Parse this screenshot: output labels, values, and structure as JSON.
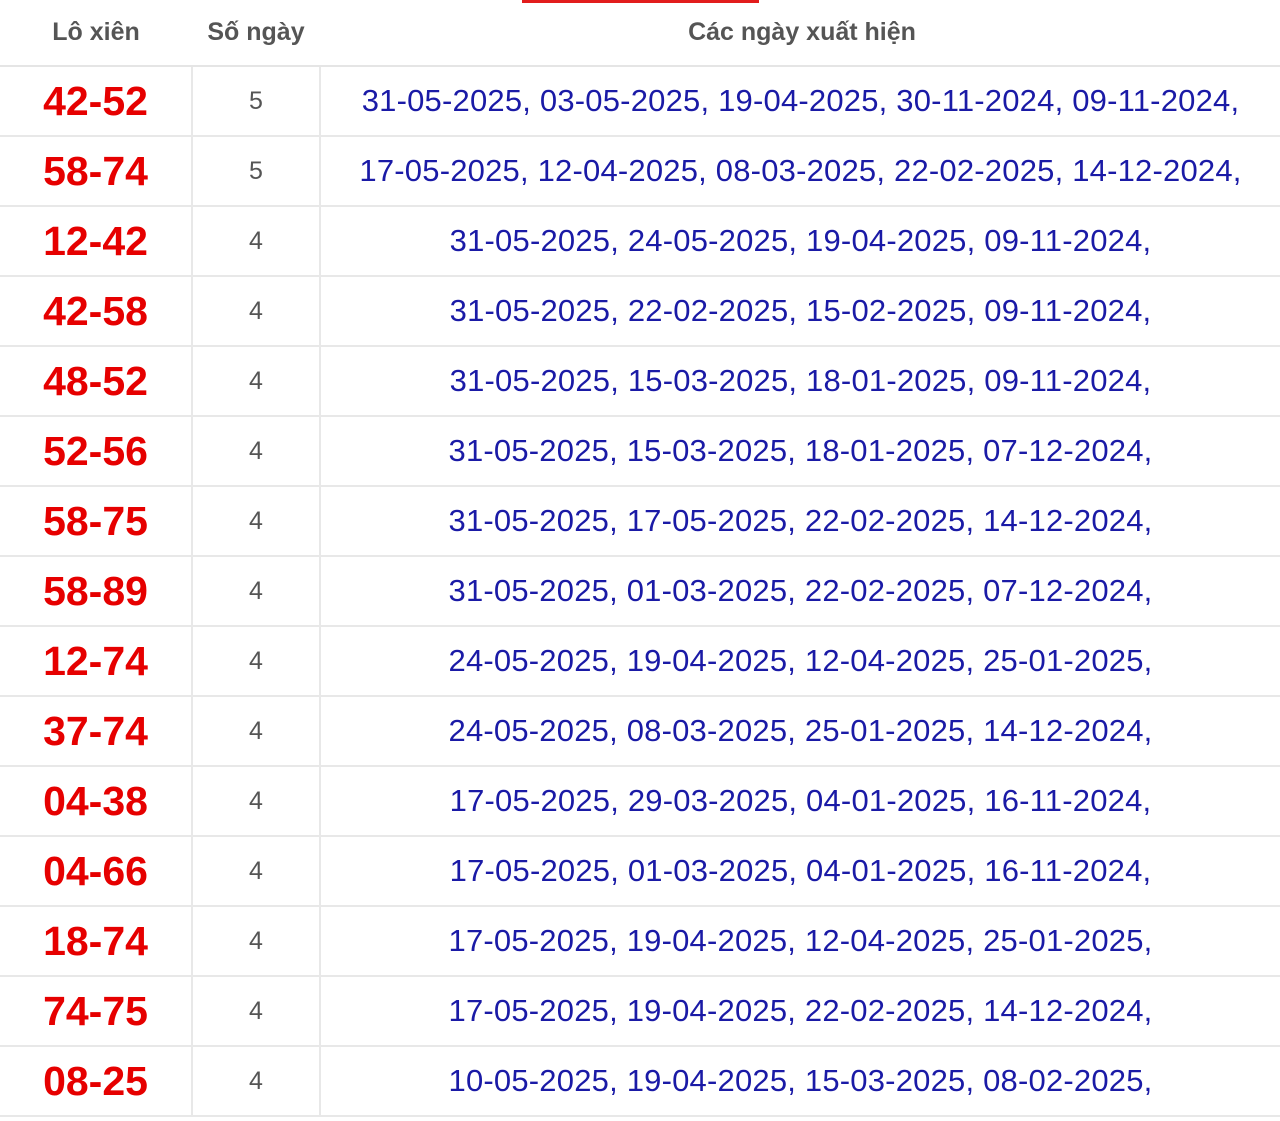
{
  "header": {
    "pair_label": "Lô xiên",
    "days_label": "Số ngày",
    "dates_label": "Các ngày xuất hiện"
  },
  "accent_color": "#e21c1c",
  "colors": {
    "pair_text": "#e60000",
    "dates_text": "#1a1aa6",
    "days_text": "#555555"
  },
  "rows": [
    {
      "pair": "42-52",
      "days": "5",
      "dates": "31-05-2025, 03-05-2025, 19-04-2025, 30-11-2024, 09-11-2024,"
    },
    {
      "pair": "58-74",
      "days": "5",
      "dates": "17-05-2025, 12-04-2025, 08-03-2025, 22-02-2025, 14-12-2024,"
    },
    {
      "pair": "12-42",
      "days": "4",
      "dates": "31-05-2025, 24-05-2025, 19-04-2025, 09-11-2024,"
    },
    {
      "pair": "42-58",
      "days": "4",
      "dates": "31-05-2025, 22-02-2025, 15-02-2025, 09-11-2024,"
    },
    {
      "pair": "48-52",
      "days": "4",
      "dates": "31-05-2025, 15-03-2025, 18-01-2025, 09-11-2024,"
    },
    {
      "pair": "52-56",
      "days": "4",
      "dates": "31-05-2025, 15-03-2025, 18-01-2025, 07-12-2024,"
    },
    {
      "pair": "58-75",
      "days": "4",
      "dates": "31-05-2025, 17-05-2025, 22-02-2025, 14-12-2024,"
    },
    {
      "pair": "58-89",
      "days": "4",
      "dates": "31-05-2025, 01-03-2025, 22-02-2025, 07-12-2024,"
    },
    {
      "pair": "12-74",
      "days": "4",
      "dates": "24-05-2025, 19-04-2025, 12-04-2025, 25-01-2025,"
    },
    {
      "pair": "37-74",
      "days": "4",
      "dates": "24-05-2025, 08-03-2025, 25-01-2025, 14-12-2024,"
    },
    {
      "pair": "04-38",
      "days": "4",
      "dates": "17-05-2025, 29-03-2025, 04-01-2025, 16-11-2024,"
    },
    {
      "pair": "04-66",
      "days": "4",
      "dates": "17-05-2025, 01-03-2025, 04-01-2025, 16-11-2024,"
    },
    {
      "pair": "18-74",
      "days": "4",
      "dates": "17-05-2025, 19-04-2025, 12-04-2025, 25-01-2025,"
    },
    {
      "pair": "74-75",
      "days": "4",
      "dates": "17-05-2025, 19-04-2025, 22-02-2025, 14-12-2024,"
    },
    {
      "pair": "08-25",
      "days": "4",
      "dates": "10-05-2025, 19-04-2025, 15-03-2025, 08-02-2025,"
    }
  ]
}
